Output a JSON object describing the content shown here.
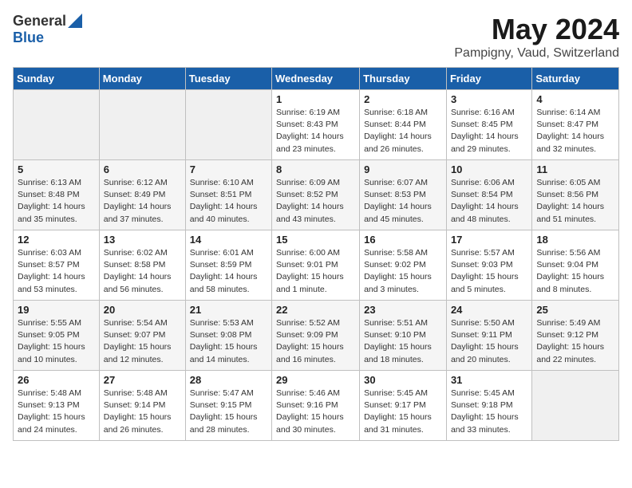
{
  "logo": {
    "general": "General",
    "blue": "Blue"
  },
  "title": {
    "month_year": "May 2024",
    "location": "Pampigny, Vaud, Switzerland"
  },
  "weekdays": [
    "Sunday",
    "Monday",
    "Tuesday",
    "Wednesday",
    "Thursday",
    "Friday",
    "Saturday"
  ],
  "weeks": [
    [
      {
        "day": "",
        "info": ""
      },
      {
        "day": "",
        "info": ""
      },
      {
        "day": "",
        "info": ""
      },
      {
        "day": "1",
        "info": "Sunrise: 6:19 AM\nSunset: 8:43 PM\nDaylight: 14 hours\nand 23 minutes."
      },
      {
        "day": "2",
        "info": "Sunrise: 6:18 AM\nSunset: 8:44 PM\nDaylight: 14 hours\nand 26 minutes."
      },
      {
        "day": "3",
        "info": "Sunrise: 6:16 AM\nSunset: 8:45 PM\nDaylight: 14 hours\nand 29 minutes."
      },
      {
        "day": "4",
        "info": "Sunrise: 6:14 AM\nSunset: 8:47 PM\nDaylight: 14 hours\nand 32 minutes."
      }
    ],
    [
      {
        "day": "5",
        "info": "Sunrise: 6:13 AM\nSunset: 8:48 PM\nDaylight: 14 hours\nand 35 minutes."
      },
      {
        "day": "6",
        "info": "Sunrise: 6:12 AM\nSunset: 8:49 PM\nDaylight: 14 hours\nand 37 minutes."
      },
      {
        "day": "7",
        "info": "Sunrise: 6:10 AM\nSunset: 8:51 PM\nDaylight: 14 hours\nand 40 minutes."
      },
      {
        "day": "8",
        "info": "Sunrise: 6:09 AM\nSunset: 8:52 PM\nDaylight: 14 hours\nand 43 minutes."
      },
      {
        "day": "9",
        "info": "Sunrise: 6:07 AM\nSunset: 8:53 PM\nDaylight: 14 hours\nand 45 minutes."
      },
      {
        "day": "10",
        "info": "Sunrise: 6:06 AM\nSunset: 8:54 PM\nDaylight: 14 hours\nand 48 minutes."
      },
      {
        "day": "11",
        "info": "Sunrise: 6:05 AM\nSunset: 8:56 PM\nDaylight: 14 hours\nand 51 minutes."
      }
    ],
    [
      {
        "day": "12",
        "info": "Sunrise: 6:03 AM\nSunset: 8:57 PM\nDaylight: 14 hours\nand 53 minutes."
      },
      {
        "day": "13",
        "info": "Sunrise: 6:02 AM\nSunset: 8:58 PM\nDaylight: 14 hours\nand 56 minutes."
      },
      {
        "day": "14",
        "info": "Sunrise: 6:01 AM\nSunset: 8:59 PM\nDaylight: 14 hours\nand 58 minutes."
      },
      {
        "day": "15",
        "info": "Sunrise: 6:00 AM\nSunset: 9:01 PM\nDaylight: 15 hours\nand 1 minute."
      },
      {
        "day": "16",
        "info": "Sunrise: 5:58 AM\nSunset: 9:02 PM\nDaylight: 15 hours\nand 3 minutes."
      },
      {
        "day": "17",
        "info": "Sunrise: 5:57 AM\nSunset: 9:03 PM\nDaylight: 15 hours\nand 5 minutes."
      },
      {
        "day": "18",
        "info": "Sunrise: 5:56 AM\nSunset: 9:04 PM\nDaylight: 15 hours\nand 8 minutes."
      }
    ],
    [
      {
        "day": "19",
        "info": "Sunrise: 5:55 AM\nSunset: 9:05 PM\nDaylight: 15 hours\nand 10 minutes."
      },
      {
        "day": "20",
        "info": "Sunrise: 5:54 AM\nSunset: 9:07 PM\nDaylight: 15 hours\nand 12 minutes."
      },
      {
        "day": "21",
        "info": "Sunrise: 5:53 AM\nSunset: 9:08 PM\nDaylight: 15 hours\nand 14 minutes."
      },
      {
        "day": "22",
        "info": "Sunrise: 5:52 AM\nSunset: 9:09 PM\nDaylight: 15 hours\nand 16 minutes."
      },
      {
        "day": "23",
        "info": "Sunrise: 5:51 AM\nSunset: 9:10 PM\nDaylight: 15 hours\nand 18 minutes."
      },
      {
        "day": "24",
        "info": "Sunrise: 5:50 AM\nSunset: 9:11 PM\nDaylight: 15 hours\nand 20 minutes."
      },
      {
        "day": "25",
        "info": "Sunrise: 5:49 AM\nSunset: 9:12 PM\nDaylight: 15 hours\nand 22 minutes."
      }
    ],
    [
      {
        "day": "26",
        "info": "Sunrise: 5:48 AM\nSunset: 9:13 PM\nDaylight: 15 hours\nand 24 minutes."
      },
      {
        "day": "27",
        "info": "Sunrise: 5:48 AM\nSunset: 9:14 PM\nDaylight: 15 hours\nand 26 minutes."
      },
      {
        "day": "28",
        "info": "Sunrise: 5:47 AM\nSunset: 9:15 PM\nDaylight: 15 hours\nand 28 minutes."
      },
      {
        "day": "29",
        "info": "Sunrise: 5:46 AM\nSunset: 9:16 PM\nDaylight: 15 hours\nand 30 minutes."
      },
      {
        "day": "30",
        "info": "Sunrise: 5:45 AM\nSunset: 9:17 PM\nDaylight: 15 hours\nand 31 minutes."
      },
      {
        "day": "31",
        "info": "Sunrise: 5:45 AM\nSunset: 9:18 PM\nDaylight: 15 hours\nand 33 minutes."
      },
      {
        "day": "",
        "info": ""
      }
    ]
  ]
}
